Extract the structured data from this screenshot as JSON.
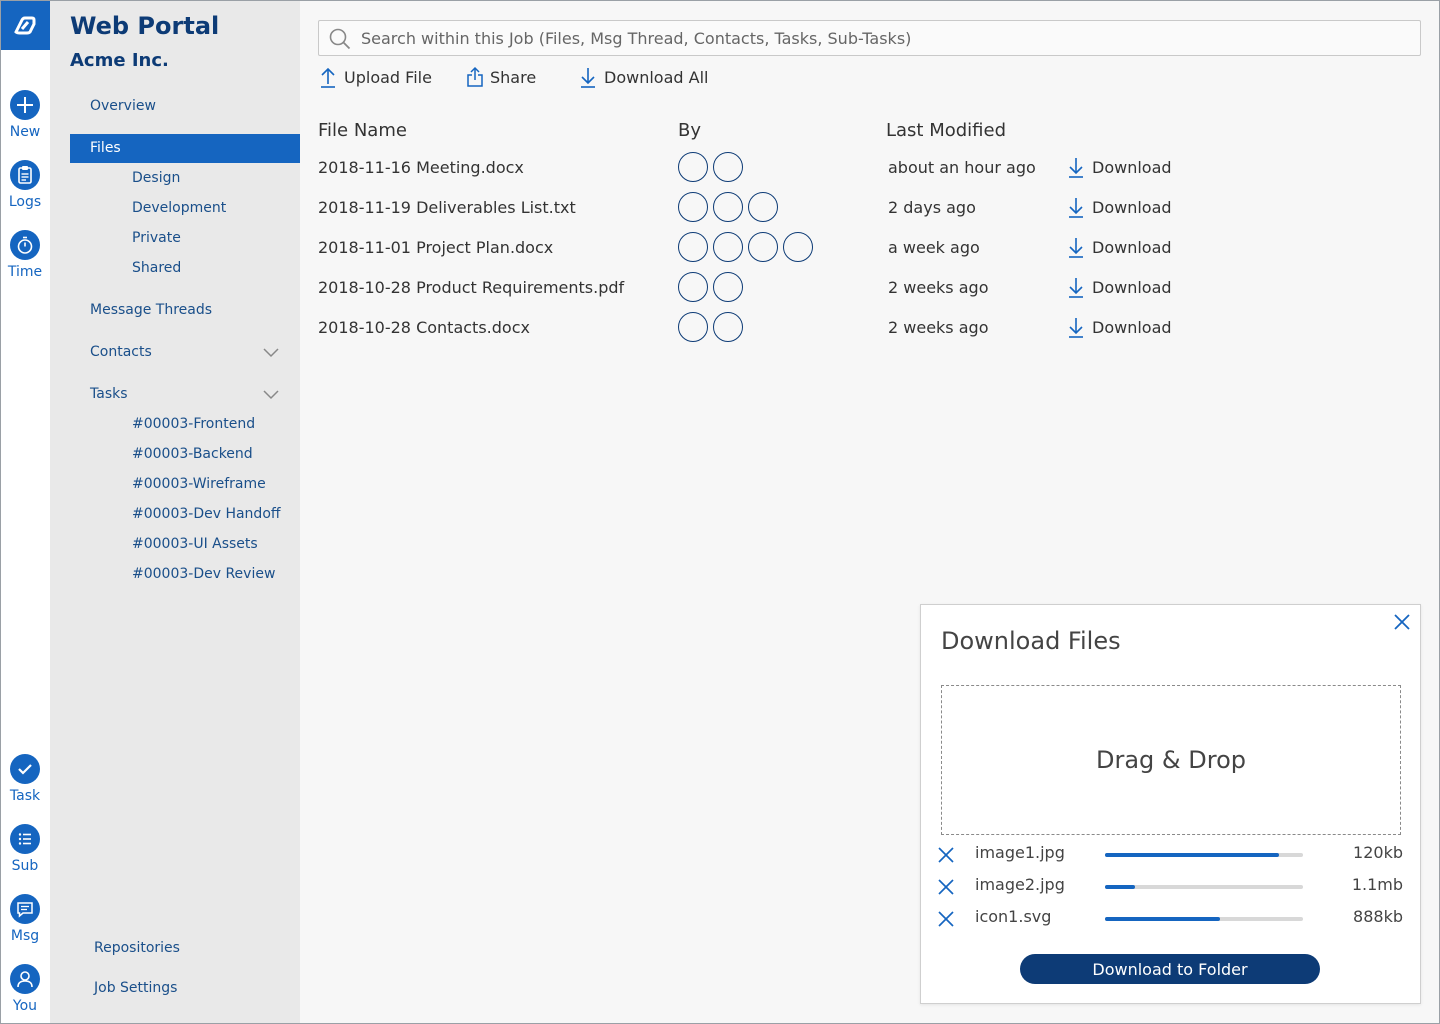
{
  "app": {
    "title": "Web Portal",
    "company": "Acme Inc.",
    "accent": "#1565c0",
    "navy": "#0d3b76"
  },
  "rail": {
    "top": [
      {
        "label": "New",
        "icon": "plus-icon"
      },
      {
        "label": "Logs",
        "icon": "clipboard-icon"
      },
      {
        "label": "Time",
        "icon": "stopwatch-icon"
      }
    ],
    "bottom": [
      {
        "label": "Task",
        "icon": "check-icon"
      },
      {
        "label": "Sub",
        "icon": "list-icon"
      },
      {
        "label": "Msg",
        "icon": "chat-icon"
      },
      {
        "label": "You",
        "icon": "user-icon"
      }
    ]
  },
  "sidebar": {
    "overview": "Overview",
    "files": "Files",
    "file_folders": [
      "Design",
      "Development",
      "Private",
      "Shared"
    ],
    "message_threads": "Message Threads",
    "contacts": "Contacts",
    "tasks": "Tasks",
    "task_items": [
      "#00003-Frontend",
      "#00003-Backend",
      "#00003-Wireframe",
      "#00003-Dev Handoff",
      "#00003-UI Assets",
      "#00003-Dev Review"
    ],
    "repositories": "Repositories",
    "job_settings": "Job Settings"
  },
  "search": {
    "placeholder": "Search within this Job (Files, Msg Thread, Contacts, Tasks, Sub-Tasks)"
  },
  "actions": {
    "upload": "Upload File",
    "share": "Share",
    "download_all": "Download All"
  },
  "table": {
    "headers": {
      "name": "File Name",
      "by": "By",
      "modified": "Last Modified"
    },
    "download_label": "Download",
    "rows": [
      {
        "name": "2018-11-16 Meeting.docx",
        "contributors": 2,
        "modified": "about an hour ago"
      },
      {
        "name": "2018-11-19 Deliverables List.txt",
        "contributors": 3,
        "modified": "2 days ago"
      },
      {
        "name": "2018-11-01 Project Plan.docx",
        "contributors": 4,
        "modified": "a week ago"
      },
      {
        "name": "2018-10-28 Product Requirements.pdf",
        "contributors": 2,
        "modified": "2 weeks ago"
      },
      {
        "name": "2018-10-28 Contacts.docx",
        "contributors": 2,
        "modified": "2 weeks ago"
      }
    ]
  },
  "panel": {
    "title": "Download Files",
    "dropzone": "Drag & Drop",
    "files": [
      {
        "name": "image1.jpg",
        "progress": 0.88,
        "size": "120kb"
      },
      {
        "name": "image2.jpg",
        "progress": 0.15,
        "size": "1.1mb"
      },
      {
        "name": "icon1.svg",
        "progress": 0.58,
        "size": "888kb"
      }
    ],
    "button": "Download to Folder"
  }
}
